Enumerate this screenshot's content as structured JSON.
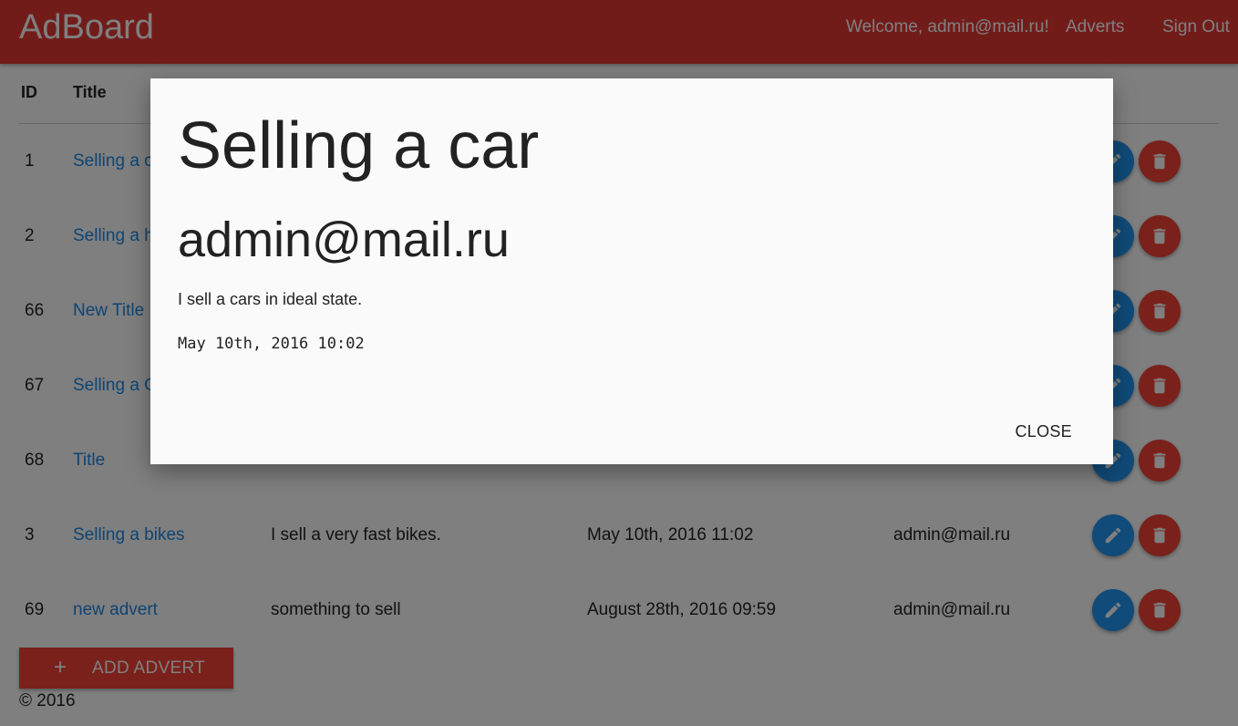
{
  "colors": {
    "primary": "#e53935",
    "link": "#1e88e5",
    "edit_button": "#2196f3",
    "delete_button": "#f44336"
  },
  "navbar": {
    "brand": "AdBoard",
    "welcome": "Welcome, admin@mail.ru!",
    "adverts": "Adverts",
    "sign_out": "Sign Out"
  },
  "table": {
    "headers": {
      "id": "ID",
      "title": "Title"
    },
    "rows": [
      {
        "id": "1",
        "title": "Selling a c",
        "message": "",
        "date": "",
        "user": ""
      },
      {
        "id": "2",
        "title": "Selling a h",
        "message": "",
        "date": "",
        "user": ""
      },
      {
        "id": "66",
        "title": "New Title",
        "message": "",
        "date": "",
        "user": ""
      },
      {
        "id": "67",
        "title": "Selling a C",
        "message": "",
        "date": "",
        "user": ""
      },
      {
        "id": "68",
        "title": "Title",
        "message": "",
        "date": "",
        "user": ""
      },
      {
        "id": "3",
        "title": "Selling a bikes",
        "message": "I sell a very fast bikes.",
        "date": "May 10th, 2016 11:02",
        "user": "admin@mail.ru"
      },
      {
        "id": "69",
        "title": "new advert",
        "message": "something to sell",
        "date": "August 28th, 2016 09:59",
        "user": "admin@mail.ru"
      }
    ],
    "row_icons": {
      "edit": "pencil-icon",
      "delete": "trash-icon"
    }
  },
  "add_button": {
    "icon": "+",
    "label": "ADD ADVERT"
  },
  "footer": {
    "text": "© 2016"
  },
  "modal": {
    "title": "Selling a car",
    "user": "admin@mail.ru",
    "text": "I sell a cars in ideal state.",
    "date": "May 10th, 2016 10:02",
    "close_label": "CLOSE"
  }
}
